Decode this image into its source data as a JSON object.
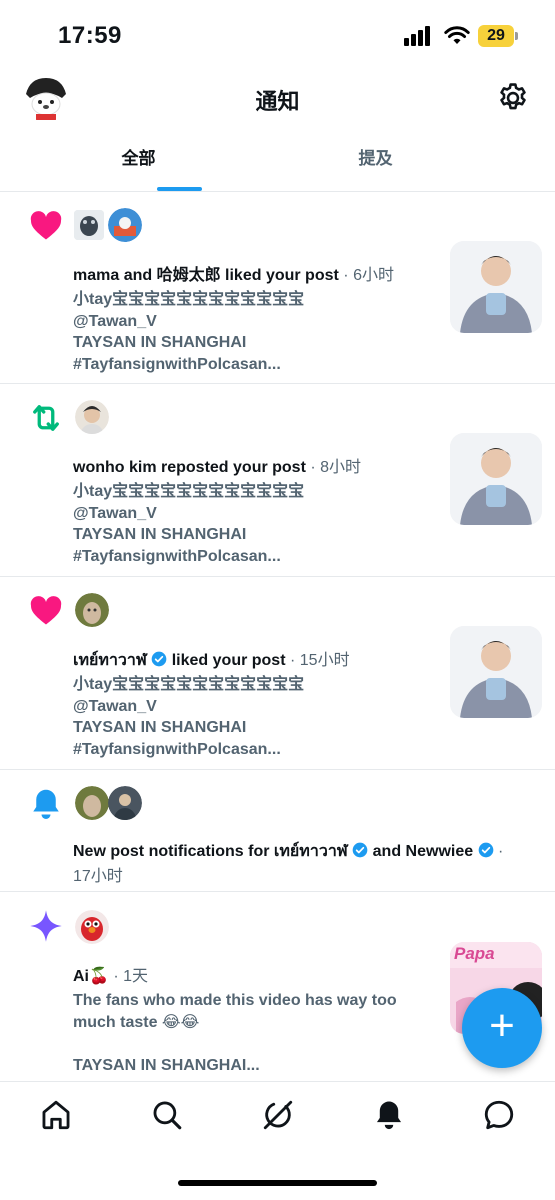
{
  "status_bar": {
    "time": "17:59",
    "battery": "29"
  },
  "header": {
    "title": "通知"
  },
  "tabs": [
    {
      "label": "全部",
      "active": true
    },
    {
      "label": "提及",
      "active": false
    }
  ],
  "notifications": [
    {
      "type": "like",
      "icon": "heart-icon",
      "actor_text": "mama and 哈姆太郎 liked your post",
      "time": "6小时",
      "lines": [
        "小tay宝宝宝宝宝宝宝宝宝宝宝宝",
        "@Tawan_V",
        "TAYSAN IN SHANGHAI",
        "#TayfansignwithPolcasan..."
      ]
    },
    {
      "type": "repost",
      "icon": "repost-icon",
      "actor_text": "wonho kim reposted your post",
      "time": "8小时",
      "lines": [
        "小tay宝宝宝宝宝宝宝宝宝宝宝宝",
        "@Tawan_V",
        "TAYSAN IN SHANGHAI",
        "#TayfansignwithPolcasan..."
      ]
    },
    {
      "type": "like",
      "icon": "heart-icon",
      "actor_name": "เทย์ทาวาฬ",
      "actor_action": "liked your post",
      "time": "15小时",
      "lines": [
        "小tay宝宝宝宝宝宝宝宝宝宝宝宝",
        "@Tawan_V",
        "TAYSAN IN SHANGHAI",
        "#TayfansignwithPolcasan..."
      ]
    },
    {
      "type": "bell",
      "icon": "bell-icon",
      "prefix": "New post notifications for",
      "name1": "เทย์ทาวาฬ",
      "conj": "and",
      "name2": "Newwiee",
      "time": "17小时"
    },
    {
      "type": "ai",
      "icon": "sparkle-icon",
      "actor_name": "Ai🍒",
      "time": "1天",
      "lines": [
        "The fans who made this video has way too",
        "much taste 😂😂",
        "",
        "TAYSAN IN SHANGHAI..."
      ],
      "thumb_text": "Papa"
    }
  ],
  "time_separator": "·",
  "colors": {
    "accent": "#1d9bf0",
    "like": "#f91880",
    "repost": "#00ba7c",
    "sparkle": "#7856ff"
  },
  "bottom_nav": [
    "home-icon",
    "search-icon",
    "grok-icon",
    "notifications-icon",
    "messages-icon"
  ]
}
